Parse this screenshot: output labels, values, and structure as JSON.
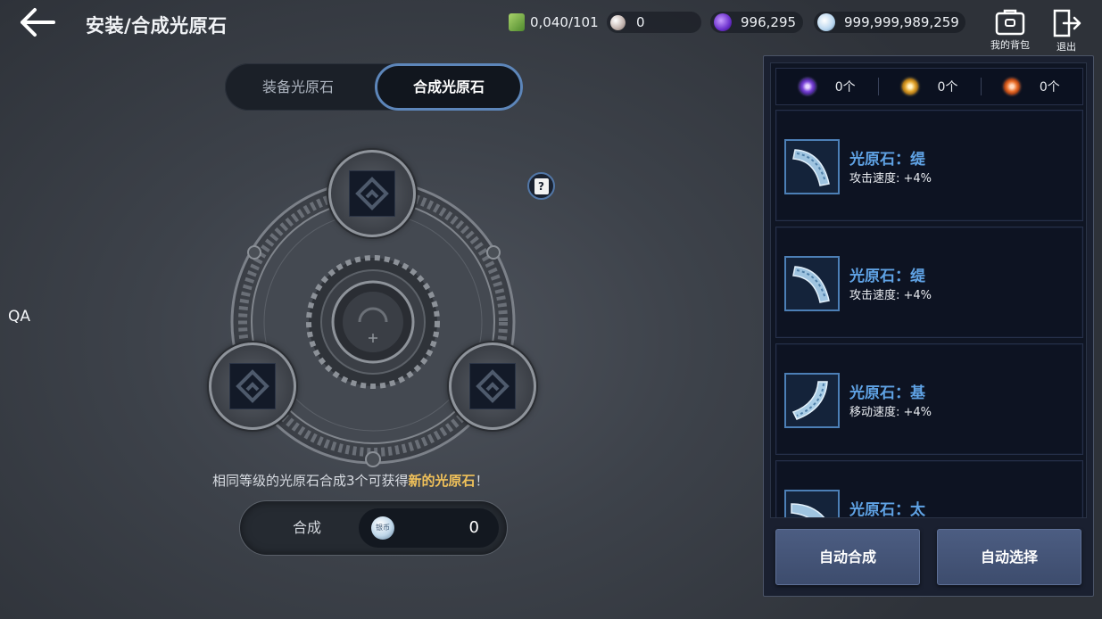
{
  "header": {
    "title": "安装/合成光原石"
  },
  "currencies": [
    {
      "icon": "cash-stack-icon",
      "value": "0,040/101"
    },
    {
      "icon": "pearl-icon",
      "value": "0"
    },
    {
      "icon": "purple-orb-icon",
      "value": "996,295"
    },
    {
      "icon": "silver-coin-icon",
      "value": "999,999,989,259"
    }
  ],
  "top_actions": {
    "bag_label": "我的背包",
    "exit_label": "退出"
  },
  "side": {
    "qa_label": "QA"
  },
  "tabs": [
    {
      "label": "装备光原石",
      "active": false
    },
    {
      "label": "合成光原石",
      "active": true
    }
  ],
  "help": {
    "glyph": "?"
  },
  "synthesis": {
    "hint_prefix": "相同等级的光原石合成3个可获得",
    "hint_highlight": "新的光原石",
    "hint_suffix": "！",
    "button_label": "合成",
    "cost_coin_text": "银币",
    "cost_value": "0"
  },
  "counters": [
    {
      "gem": "purple-gem-icon",
      "value": "0个",
      "color": "#7a44d8"
    },
    {
      "gem": "gold-gem-icon",
      "value": "0个",
      "color": "#e3a52c"
    },
    {
      "gem": "orange-gem-icon",
      "value": "0个",
      "color": "#ec6f2a"
    }
  ],
  "items": [
    {
      "name": "光原石：缇",
      "stat": "攻击速度: +4%"
    },
    {
      "name": "光原石：缇",
      "stat": "攻击速度: +4%"
    },
    {
      "name": "光原石：基",
      "stat": "移动速度: +4%"
    },
    {
      "name": "光原石：太",
      "stat": ""
    }
  ],
  "panel_buttons": {
    "auto_synth": "自动合成",
    "auto_select": "自动选择"
  },
  "colors": {
    "accent_blue": "#5d86ba",
    "highlight_gold": "#f0c15a",
    "item_name": "#5fa2e4"
  }
}
